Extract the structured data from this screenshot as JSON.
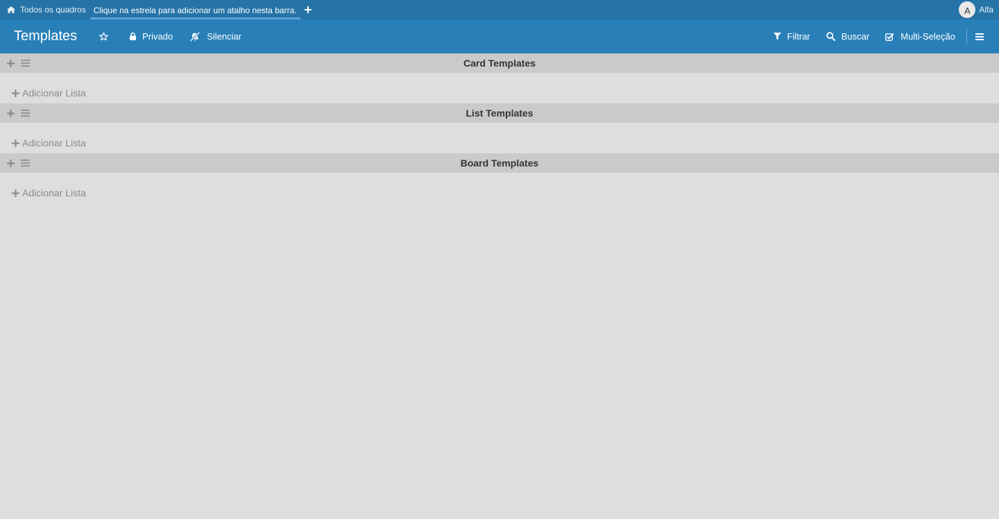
{
  "topbar": {
    "all_boards_label": "Todos os quadros",
    "shortcut_hint": "Clique na estrela para adicionar um atalho nesta barra.",
    "user": {
      "avatar_initial": "A",
      "name": "Alfa"
    }
  },
  "header": {
    "board_title": "Templates",
    "star_icon": "star-outline-icon",
    "privacy_label": "Privado",
    "mute_label": "Silenciar",
    "filter_label": "Filtrar",
    "search_label": "Buscar",
    "multiselect_label": "Multi-Seleção",
    "menu_icon": "hamburger-icon"
  },
  "swimlanes": [
    {
      "title": "Card Templates",
      "add_list_label": "Adicionar Lista"
    },
    {
      "title": "List Templates",
      "add_list_label": "Adicionar Lista"
    },
    {
      "title": "Board Templates",
      "add_list_label": "Adicionar Lista"
    }
  ],
  "colors": {
    "topbar_bg": "#2573a7",
    "header_bg": "#2980b9",
    "lane_header_bg": "#cacaca",
    "canvas_bg": "#dedede"
  }
}
